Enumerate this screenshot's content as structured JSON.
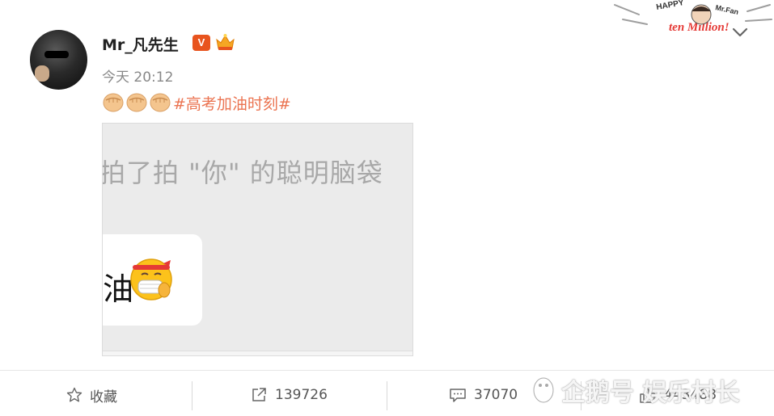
{
  "post": {
    "username": "Mr_凡先生",
    "verified_badge": "V",
    "timestamp": "今天 20:12",
    "emoji_icons": [
      "fist-emoji",
      "fist-emoji",
      "fist-emoji"
    ],
    "hashtag": "#高考加油时刻#",
    "image": {
      "caption": "拍了拍 \"你\" 的聪明脑袋",
      "bubble_text": "油",
      "emoji": "mask-salute-emoji"
    }
  },
  "header": {
    "sticker_text_1": "HAPPY",
    "sticker_text_2": "ten Million!",
    "sticker_text_3": "Mr.Fan",
    "menu_icon": "chevron-down-icon"
  },
  "actions": {
    "favorite_label": "收藏",
    "repost_count": "139726",
    "comment_count": "37070",
    "like_count": "443488"
  },
  "watermark": {
    "text": "企鹅号 娱乐村长"
  },
  "colors": {
    "hashtag": "#eb7350",
    "verified": "#e8541e",
    "muted_text": "#888888"
  }
}
